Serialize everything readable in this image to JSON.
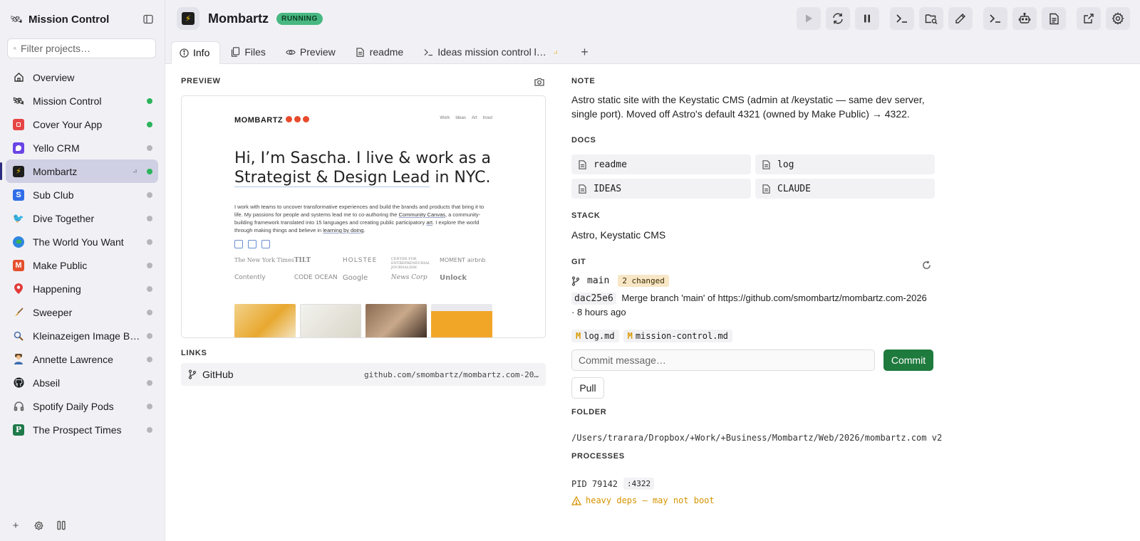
{
  "sidebar": {
    "title": "Mission Control",
    "search_placeholder": "Filter projects…",
    "items": [
      {
        "label": "Overview",
        "icon": "home-icon",
        "dot": ""
      },
      {
        "label": "Mission Control",
        "icon": "satellite-icon",
        "dot": "green"
      },
      {
        "label": "Cover Your App",
        "icon": "cover-your-app-icon",
        "dot": "green"
      },
      {
        "label": "Yello CRM",
        "icon": "yello-crm-icon",
        "dot": "gray"
      },
      {
        "label": "Mombartz",
        "icon": "lightning-icon",
        "dot": "green",
        "active": true
      },
      {
        "label": "Sub Club",
        "icon": "sub-club-icon",
        "dot": "gray"
      },
      {
        "label": "Dive Together",
        "icon": "dive-icon",
        "dot": "gray"
      },
      {
        "label": "The World You Want",
        "icon": "globe-icon",
        "dot": "gray"
      },
      {
        "label": "Make Public",
        "icon": "make-public-icon",
        "dot": "gray"
      },
      {
        "label": "Happening",
        "icon": "pin-icon",
        "dot": "gray"
      },
      {
        "label": "Sweeper",
        "icon": "broom-icon",
        "dot": "gray"
      },
      {
        "label": "Kleinazeigen Image Br…",
        "icon": "magnifier-icon",
        "dot": "gray"
      },
      {
        "label": "Annette Lawrence",
        "icon": "person-icon",
        "dot": "gray"
      },
      {
        "label": "Abseil",
        "icon": "github-icon",
        "dot": "gray"
      },
      {
        "label": "Spotify Daily Pods",
        "icon": "headphones-icon",
        "dot": "gray"
      },
      {
        "label": "The Prospect Times",
        "icon": "prospect-times-icon",
        "dot": "gray"
      }
    ]
  },
  "header": {
    "project_name": "Mombartz",
    "status": "RUNNING"
  },
  "tabs": [
    {
      "label": "Info",
      "active": true
    },
    {
      "label": "Files"
    },
    {
      "label": "Preview"
    },
    {
      "label": "readme"
    },
    {
      "label": "Ideas mission control l…"
    }
  ],
  "preview": {
    "heading": "PREVIEW",
    "site": {
      "brand": "MOMBARTZ",
      "nav": [
        "Work",
        "Ideas",
        "Art",
        "Inout"
      ],
      "headline_1": "Hi, I’m Sascha. I live & work as a",
      "headline_2a": "Strategist & Design Lead",
      "headline_2b": " in NYC.",
      "para_1": "I work with teams to uncover transformative experiences and build the brands and products that bring it to life. My passions for people and systems lead me to co-authoring the ",
      "para_link_1": "Community Canvas",
      "para_2": ", a community-building framework translated into 15 languages and creating public participatory ",
      "para_link_2": "art",
      "para_3": ". I explore the world through making things and believe in ",
      "para_link_3": "learning by doing",
      "para_4": ".",
      "logos": [
        "The New York Times",
        "TILT",
        "HOLSTEE",
        "CENTER FOR ENTREPRENEURIAL JOURNALISM",
        "MOMENT",
        "Contently",
        "CODE OCEAN",
        "Google",
        "News Corp",
        "Unlock"
      ],
      "extra_logo": "airbnb"
    }
  },
  "links": {
    "heading": "LINKS",
    "items": [
      {
        "label": "GitHub",
        "url": "github.com/smombartz/mombartz.com-20…"
      }
    ]
  },
  "note": {
    "heading": "NOTE",
    "text": "Astro static site with the Keystatic CMS (admin at /keystatic — same dev server, single port). Moved off Astro's default 4321 (owned by Make Public) → 4322."
  },
  "docs": {
    "heading": "DOCS",
    "items": [
      "readme",
      "log",
      "IDEAS",
      "CLAUDE"
    ]
  },
  "stack": {
    "heading": "STACK",
    "text": "Astro, Keystatic CMS"
  },
  "git": {
    "heading": "GIT",
    "branch": "main",
    "changed": "2 changed",
    "sha": "dac25e6",
    "message": "Merge branch 'main' of https://github.com/smombartz/mombartz.com-2026",
    "time": "· 8 hours ago",
    "files": [
      {
        "status": "M",
        "name": "log.md"
      },
      {
        "status": "M",
        "name": "mission-control.md"
      }
    ],
    "commit_placeholder": "Commit message…",
    "commit_label": "Commit",
    "pull_label": "Pull"
  },
  "folder": {
    "heading": "FOLDER",
    "path": "/Users/trarara/Dropbox/+Work/+Business/Mombartz/Web/2026/mombartz.com v2"
  },
  "processes": {
    "heading": "PROCESSES",
    "pid": "PID 79142",
    "port": ":4322",
    "warning": "heavy deps — may not boot"
  },
  "colors": {
    "running": "#47b881",
    "online_dot": "#2cb45b",
    "offline_dot": "#b5b5bb",
    "commit_button": "#1e7a3d",
    "warning": "#d59400",
    "active_item": "#cfd0e3"
  }
}
